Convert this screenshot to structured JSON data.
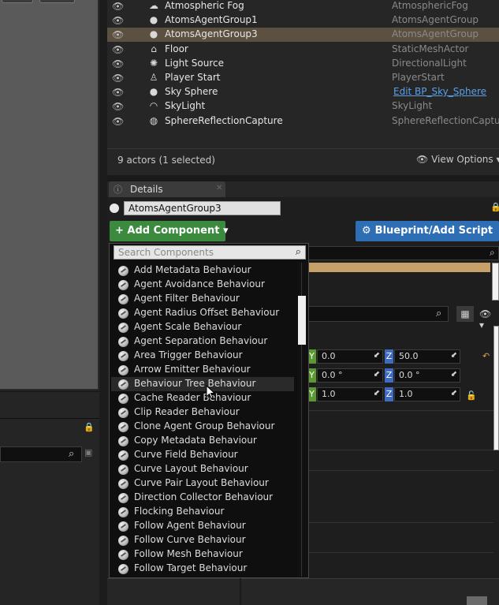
{
  "outliner": {
    "rows": [
      {
        "icon": "fog-icon",
        "glyph": "☁",
        "label": "Atmospheric Fog",
        "type": "AtmosphericFog",
        "selected": false,
        "link": false
      },
      {
        "icon": "agent-group-icon",
        "glyph": "●",
        "label": "AtomsAgentGroup1",
        "type": "AtomsAgentGroup",
        "selected": false,
        "link": false
      },
      {
        "icon": "agent-group-icon",
        "glyph": "●",
        "label": "AtomsAgentGroup3",
        "type": "AtomsAgentGroup",
        "selected": true,
        "link": false
      },
      {
        "icon": "static-mesh-icon",
        "glyph": "⌂",
        "label": "Floor",
        "type": "StaticMeshActor",
        "selected": false,
        "link": false
      },
      {
        "icon": "light-icon",
        "glyph": "✺",
        "label": "Light Source",
        "type": "DirectionalLight",
        "selected": false,
        "link": false
      },
      {
        "icon": "player-start-icon",
        "glyph": "♙",
        "label": "Player Start",
        "type": "PlayerStart",
        "selected": false,
        "link": false
      },
      {
        "icon": "sky-sphere-icon",
        "glyph": "●",
        "label": "Sky Sphere",
        "type": "Edit BP_Sky_Sphere",
        "selected": false,
        "link": true
      },
      {
        "icon": "skylight-icon",
        "glyph": "◠",
        "label": "SkyLight",
        "type": "SkyLight",
        "selected": false,
        "link": false
      },
      {
        "icon": "reflection-capture-icon",
        "glyph": "◍",
        "label": "SphereReflectionCapture",
        "type": "SphereReflectionCapture",
        "selected": false,
        "link": false
      }
    ],
    "actor_count": "9 actors (1 selected)",
    "view_options": "View Options"
  },
  "details": {
    "tab_label": "Details",
    "actor_name": "AtomsAgentGroup3",
    "add_component_label": "+ Add Component ▾",
    "blueprint_label": "Blueprint/Add Script"
  },
  "transform": [
    {
      "y": "0.0",
      "z": "50.0",
      "reset": true
    },
    {
      "y": "0.0 °",
      "z": "0.0 °",
      "reset": false
    },
    {
      "y": "1.0",
      "z": "1.0",
      "reset": false
    }
  ],
  "dropdown": {
    "search_placeholder": "Search Components",
    "items": [
      "Add Metadata Behaviour",
      "Agent Avoidance Behaviour",
      "Agent Filter Behaviour",
      "Agent Radius Offset Behaviour",
      "Agent Scale Behaviour",
      "Agent Separation Behaviour",
      "Area Trigger Behaviour",
      "Arrow Emitter Behaviour",
      "Behaviour Tree Behaviour",
      "Cache Reader Behaviour",
      "Clip Reader Behaviour",
      "Clone Agent Group Behaviour",
      "Copy Metadata Behaviour",
      "Curve Field Behaviour",
      "Curve Layout Behaviour",
      "Curve Pair Layout Behaviour",
      "Direction Collector Behaviour",
      "Flocking Behaviour",
      "Follow Agent Behaviour",
      "Follow Curve Behaviour",
      "Follow Mesh Behaviour",
      "Follow Target Behaviour"
    ],
    "hovered_index": 8
  },
  "colors": {
    "add_component": "#3b8a3e",
    "blueprint": "#2d6eb5",
    "selected_row": "#c7a06a",
    "axis_y": "#5b9a31",
    "axis_z": "#3d6bc4"
  }
}
